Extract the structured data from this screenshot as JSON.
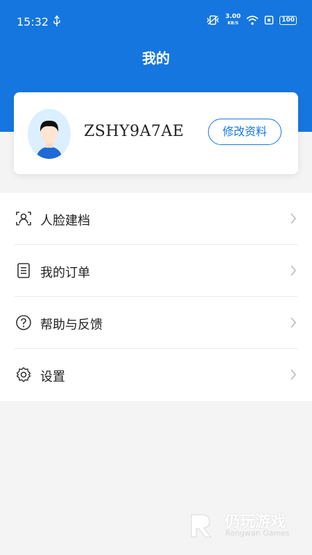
{
  "status_bar": {
    "time": "15:32",
    "net_speed": "3.00",
    "net_unit": "KB/S",
    "battery": "100"
  },
  "header": {
    "title": "我的"
  },
  "profile": {
    "username": "ZSHY9A7AE",
    "edit_label": "修改资料"
  },
  "menu": {
    "items": [
      {
        "label": "人脸建档",
        "icon": "face-scan-icon"
      },
      {
        "label": "我的订单",
        "icon": "order-list-icon"
      },
      {
        "label": "帮助与反馈",
        "icon": "help-icon"
      },
      {
        "label": "设置",
        "icon": "settings-icon"
      }
    ]
  },
  "watermark": {
    "title": "仍玩游戏",
    "subtitle": "Rengwan Games"
  },
  "colors": {
    "brand": "#1576e0",
    "page_bg": "#f4f4f4"
  }
}
